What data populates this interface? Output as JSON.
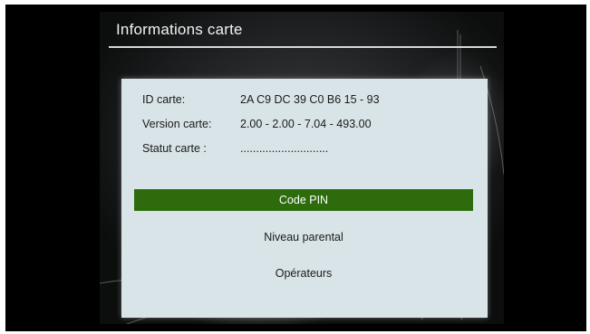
{
  "title": "Informations carte",
  "card": {
    "id_label": "ID carte:",
    "id_value": "2A C9 DC 39 C0 B6 15 - 93",
    "version_label": "Version carte:",
    "version_value": "2.00 - 2.00 - 7.04 - 493.00",
    "status_label": "Statut carte :",
    "status_value": "............................"
  },
  "menu": {
    "items": [
      {
        "label": "Code PIN",
        "selected": true
      },
      {
        "label": "Niveau parental",
        "selected": false
      },
      {
        "label": "Opérateurs",
        "selected": false
      }
    ]
  },
  "colors": {
    "selected_bg": "#2e6b0d",
    "panel_bg": "#d9e4e8",
    "screen_bg": "#2a2c2d"
  }
}
